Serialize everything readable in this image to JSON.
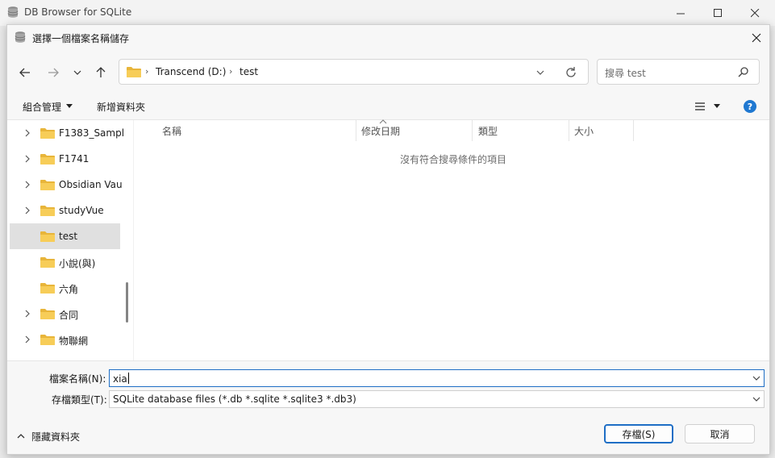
{
  "app": {
    "title": "DB Browser for SQLite"
  },
  "dialog": {
    "title": "選擇一個檔案名稱儲存",
    "breadcrumbs": [
      "Transcend (D:)",
      "test"
    ],
    "search_placeholder": "搜尋 test",
    "toolbar": {
      "organize": "組合管理",
      "new_folder": "新增資料夾",
      "help": "?"
    },
    "tree": [
      {
        "label": "F1383_Sampl",
        "expandable": true,
        "selected": false
      },
      {
        "label": "F1741",
        "expandable": true,
        "selected": false
      },
      {
        "label": "Obsidian Vau",
        "expandable": true,
        "selected": false
      },
      {
        "label": "studyVue",
        "expandable": true,
        "selected": false
      },
      {
        "label": "test",
        "expandable": false,
        "selected": true
      },
      {
        "label": "小說(與)",
        "expandable": false,
        "selected": false
      },
      {
        "label": "六角",
        "expandable": false,
        "selected": false
      },
      {
        "label": "合同",
        "expandable": true,
        "selected": false
      },
      {
        "label": "物聯網",
        "expandable": true,
        "selected": false
      }
    ],
    "columns": [
      "名稱",
      "修改日期",
      "類型",
      "大小"
    ],
    "empty_message": "沒有符合搜尋條件的項目",
    "file_name_label": "檔案名稱(N):",
    "file_name_value": "xia",
    "file_type_label": "存檔類型(T):",
    "file_type_value": "SQLite database files (*.db *.sqlite *.sqlite3 *.db3)",
    "hide_folders": "隱藏資料夾",
    "save_button": "存檔(S)",
    "cancel_button": "取消"
  },
  "colors": {
    "accent": "#1e6ec5",
    "folder": "#f2c94c",
    "selected_row": "#e0e0e0"
  },
  "icons": [
    "database-icon",
    "close-icon",
    "back-arrow-icon",
    "forward-arrow-icon",
    "chevron-down-icon",
    "up-arrow-icon",
    "folder-icon",
    "refresh-icon",
    "search-icon",
    "view-icon",
    "help-icon",
    "chevron-right-icon",
    "chevron-up-icon"
  ]
}
